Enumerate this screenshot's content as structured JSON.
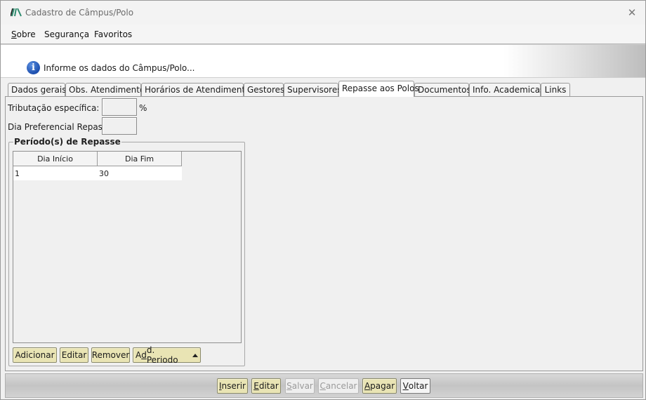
{
  "window": {
    "title": "Cadastro de Câmpus/Polo",
    "close_symbol": "✕",
    "icon": "app-logo-icon"
  },
  "menu": {
    "items": [
      {
        "label_u": "S",
        "label_rest": "obre"
      },
      {
        "label": "Segurança"
      },
      {
        "label": "Favoritos"
      }
    ]
  },
  "info": {
    "icon": "info-icon",
    "icon_glyph": "i",
    "text": "Informe os dados do Câmpus/Polo..."
  },
  "tabs": [
    {
      "label": "Dados gerais"
    },
    {
      "label": "Obs. Atendimento"
    },
    {
      "label": "Horários de Atendimento"
    },
    {
      "label": "Gestores"
    },
    {
      "label": "Supervisores"
    },
    {
      "label": "Repasse aos Polos",
      "active": true
    },
    {
      "label": "Documentos"
    },
    {
      "label": "Info. Academicas"
    },
    {
      "label": "Links"
    }
  ],
  "form": {
    "tributacao_label": "Tributação específica:",
    "tributacao_value": "",
    "tributacao_unit": "%",
    "dia_preferencial_label": "Dia Preferencial Repasse:",
    "dia_preferencial_value": ""
  },
  "periodos": {
    "title": "Período(s) de Repasse",
    "columns": [
      "Dia Início",
      "Dia Fim"
    ],
    "rows": [
      {
        "dia_inicio": "1",
        "dia_fim": "30"
      }
    ],
    "buttons": {
      "adicionar": "Adicionar",
      "editar": "Editar",
      "remover": "Remover",
      "add_periodo_pre": "A",
      "add_periodo_u": "d",
      "add_periodo_post": "d. Periodo"
    }
  },
  "actions": {
    "inserir_u": "I",
    "inserir_rest": "nserir",
    "editar_u": "E",
    "editar_rest": "ditar",
    "salvar_u": "S",
    "salvar_rest": "alvar",
    "cancelar_u": "C",
    "cancelar_rest": "ancelar",
    "apagar_u": "A",
    "apagar_rest": "pagar",
    "voltar_u": "V",
    "voltar_rest": "oltar",
    "disabled": [
      "salvar",
      "cancelar"
    ]
  },
  "colors": {
    "button_face": "#e9e4b4",
    "logo_accent": "#2e8b6e",
    "info_blue": "#1d4fae"
  }
}
